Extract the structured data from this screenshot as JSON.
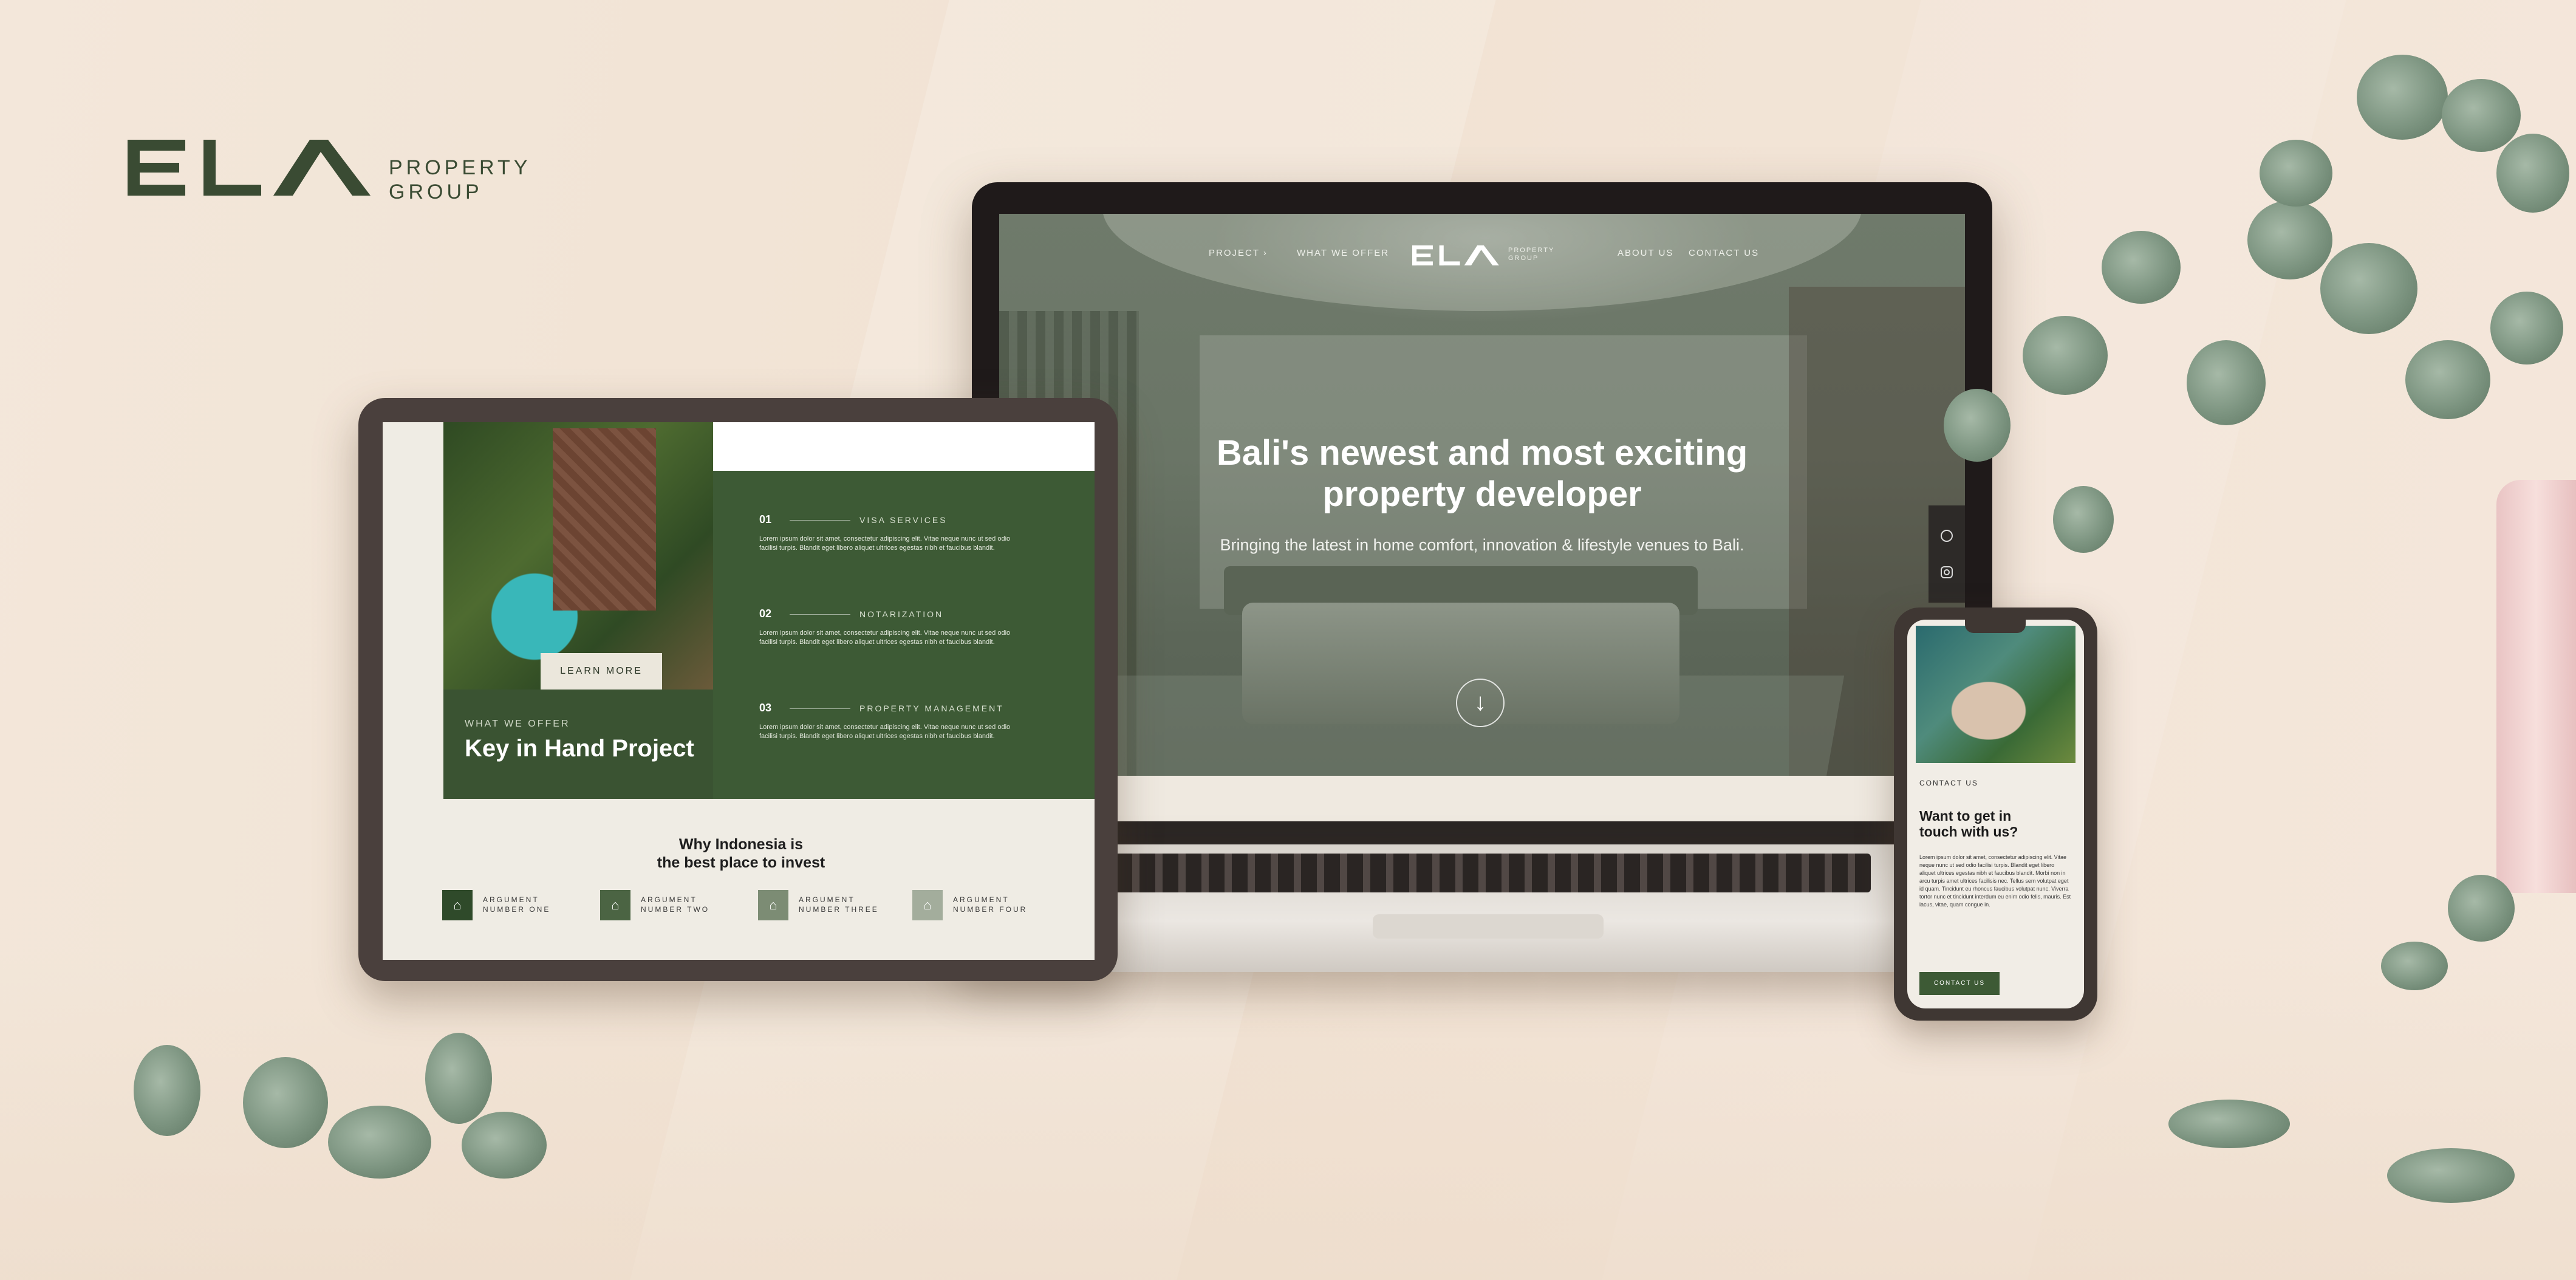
{
  "brand": {
    "word": "ELA",
    "line1": "PROPERTY",
    "line2": "GROUP"
  },
  "laptop": {
    "nav": {
      "project": "PROJECT ›",
      "what_we_offer": "WHAT WE OFFER",
      "logo_word": "ELA",
      "logo_line1": "PROPERTY",
      "logo_line2": "GROUP",
      "about": "ABOUT US",
      "contact": "CONTACT US"
    },
    "hero": {
      "title_line1": "Bali's newest and most exciting",
      "title_line2": "property developer",
      "subtitle": "Bringing the latest in home comfort, innovation & lifestyle venues to Bali.",
      "scroll_icon": "↓"
    },
    "side_icons": [
      "whatsapp-icon",
      "instagram-icon"
    ]
  },
  "tablet": {
    "learn_more": "LEARN MORE",
    "what_we_offer": "WHAT WE OFFER",
    "title": "Key in Hand Project",
    "services": [
      {
        "num": "01",
        "label": "VISA SERVICES",
        "lorem": "Lorem ipsum dolor sit amet, consectetur adipiscing elit. Vitae neque nunc ut sed odio facilisi turpis. Blandit eget libero aliquet ultrices egestas nibh et faucibus blandit."
      },
      {
        "num": "02",
        "label": "NOTARIZATION",
        "lorem": "Lorem ipsum dolor sit amet, consectetur adipiscing elit. Vitae neque nunc ut sed odio facilisi turpis. Blandit eget libero aliquet ultrices egestas nibh et faucibus blandit."
      },
      {
        "num": "03",
        "label": "PROPERTY MANAGEMENT",
        "lorem": "Lorem ipsum dolor sit amet, consectetur adipiscing elit. Vitae neque nunc ut sed odio facilisi turpis. Blandit eget libero aliquet ultrices egestas nibh et faucibus blandit."
      }
    ],
    "why_line1": "Why Indonesia is",
    "why_line2": "the best place to invest",
    "arguments": [
      {
        "line1": "ARGUMENT",
        "line2": "NUMBER ONE",
        "color": "#2f4a2a"
      },
      {
        "line1": "ARGUMENT",
        "line2": "NUMBER TWO",
        "color": "#4b6443"
      },
      {
        "line1": "ARGUMENT",
        "line2": "NUMBER THREE",
        "color": "#7c8c74"
      },
      {
        "line1": "ARGUMENT",
        "line2": "NUMBER FOUR",
        "color": "#a3ad9c"
      }
    ]
  },
  "phone": {
    "contact_label": "CONTACT US",
    "title_line1": "Want to get in",
    "title_line2": "touch with us?",
    "lorem": "Lorem ipsum dolor sit amet, consectetur adipiscing elit. Vitae neque nunc ut sed odio facilisi turpis. Blandit eget libero aliquet ultrices egestas nibh et faucibus blandit. Morbi non in arcu turpis amet ultrices facilisis nec. Tellus sem volutpat eget id quam. Tincidunt eu rhoncus faucibus volutpat nunc. Viverra tortor nunc et tincidunt interdum eu enim odio felis, mauris. Est lacus, vitae, quam congue in.",
    "button": "CONTACT US"
  },
  "colors": {
    "brand_green": "#3d5a35",
    "background": "#f3e7da"
  }
}
